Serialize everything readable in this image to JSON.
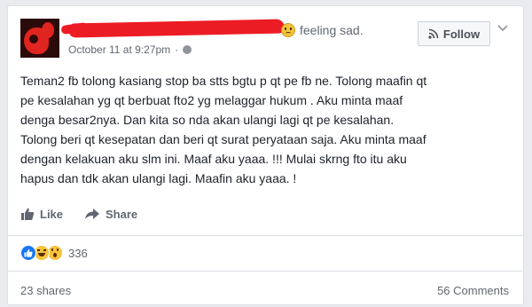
{
  "post": {
    "feeling": "feeling sad.",
    "timestamp": "October 11 at 9:27pm",
    "separator": "·",
    "follow_label": "Follow",
    "text": "Teman2 fb tolong kasiang stop ba stts bgtu p qt pe fb ne. Tolong maafin qt\npe kesalahan yg qt berbuat fto2 yg melaggar hukum . Aku minta maaf\ndenga besar2nya. Dan kita so nda akan ulangi lagi qt pe kesalahan.\nTolong beri qt kesepatan dan beri qt surat peryataan saja. Aku minta maaf\ndengan kelakuan aku slm ini. Maaf aku yaaa. !!! Mulai skrng fto itu aku\nhapus dan tdk akan ulangi lagi. Maafin aku yaaa. !"
  },
  "actions": {
    "like_label": "Like",
    "share_label": "Share"
  },
  "stats": {
    "reactions_count": "336",
    "shares_label": "23 shares",
    "comments_label": "56 Comments"
  },
  "icons": {
    "avatar": "profile-avatar",
    "feeling": "sad-face-icon",
    "privacy": "globe-icon",
    "follow": "rss-icon",
    "menu": "chevron-down-icon",
    "like": "thumbs-up-icon",
    "share": "share-arrow-icon",
    "reactions": [
      "like-reaction-icon",
      "haha-reaction-icon",
      "wow-reaction-icon"
    ]
  },
  "colors": {
    "redaction": "#ec1c24",
    "like_blue": "#1877f2",
    "text": "#1d2129",
    "muted": "#606770"
  }
}
